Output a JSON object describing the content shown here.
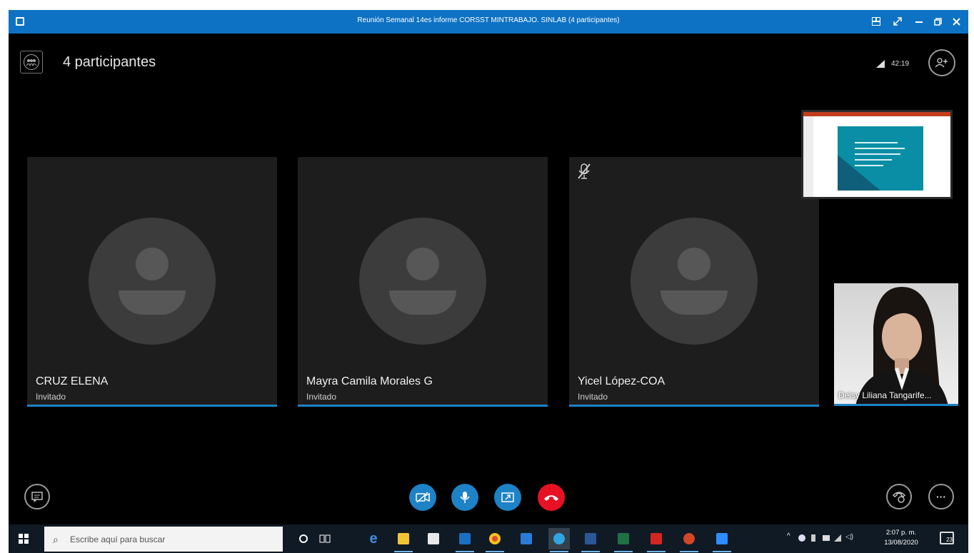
{
  "window": {
    "title": "Reunión Semanal 14es informe CORSST MINTRABAJO. SINLAB (4 participantes)"
  },
  "header": {
    "participants_count": "4 participantes",
    "call_timer": "42:19"
  },
  "participants": [
    {
      "name": "CRUZ ELENA",
      "role": "Invitado",
      "muted": false
    },
    {
      "name": "Mayra Camila Morales G",
      "role": "Invitado",
      "muted": false
    },
    {
      "name": "Yicel López-COA",
      "role": "Invitado",
      "muted": true
    }
  ],
  "self_view": {
    "name": "Deisy Liliana Tangarife..."
  },
  "taskbar": {
    "search_placeholder": "Escribe aquí para buscar",
    "clock_time": "2:07 p. m.",
    "clock_date": "13/08/2020",
    "notifications_count": "23",
    "apps": [
      "cortana-icon",
      "task-view-icon",
      "edge-icon",
      "file-explorer-icon",
      "store-icon",
      "outlook-icon",
      "chrome-icon",
      "mail-icon",
      "skype-icon",
      "word-icon",
      "excel-icon",
      "acrobat-icon",
      "powerpoint-icon",
      "zoom-icon"
    ]
  },
  "colors": {
    "accent": "#1d82c6",
    "hangup": "#e81123",
    "titlebar": "#0e72c4"
  }
}
